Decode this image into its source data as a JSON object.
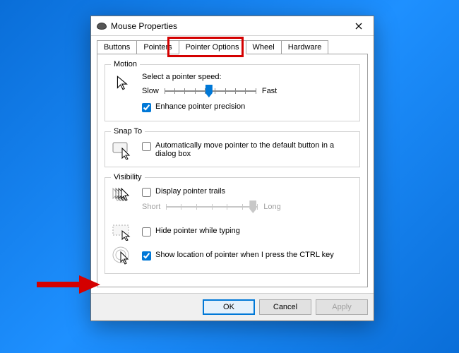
{
  "window": {
    "title": "Mouse Properties"
  },
  "tabs": {
    "items": [
      "Buttons",
      "Pointers",
      "Pointer Options",
      "Wheel",
      "Hardware"
    ],
    "active_index": 2
  },
  "groups": {
    "motion": {
      "legend": "Motion",
      "speed_label": "Select a pointer speed:",
      "slow": "Slow",
      "fast": "Fast",
      "enhance_label": "Enhance pointer precision",
      "enhance_checked": true,
      "speed_value": 5,
      "speed_max": 10
    },
    "snap": {
      "legend": "Snap To",
      "auto_label": "Automatically move pointer to the default button in a dialog box",
      "auto_checked": false
    },
    "visibility": {
      "legend": "Visibility",
      "trails_label": "Display pointer trails",
      "trails_checked": false,
      "short": "Short",
      "long": "Long",
      "hide_label": "Hide pointer while typing",
      "hide_checked": false,
      "ctrl_label": "Show location of pointer when I press the CTRL key",
      "ctrl_checked": true
    }
  },
  "buttons": {
    "ok": "OK",
    "cancel": "Cancel",
    "apply": "Apply"
  }
}
